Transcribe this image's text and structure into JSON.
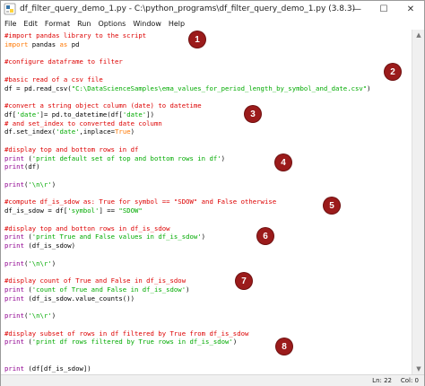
{
  "window": {
    "title": "df_filter_query_demo_1.py - C:\\python_programs\\df_filter_query_demo_1.py (3.8.3)",
    "minimize_glyph": "—",
    "maximize_glyph": "☐",
    "close_glyph": "✕",
    "app_icon": "python-idle-icon"
  },
  "menu": [
    "File",
    "Edit",
    "Format",
    "Run",
    "Options",
    "Window",
    "Help"
  ],
  "code_lines": [
    [
      {
        "t": "#import pandas library to the script",
        "c": "comment"
      }
    ],
    [
      {
        "t": "import",
        "c": "kw"
      },
      {
        "t": " pandas ",
        "c": "plain"
      },
      {
        "t": "as",
        "c": "kw"
      },
      {
        "t": " pd",
        "c": "plain"
      }
    ],
    [],
    [
      {
        "t": "#configure dataframe to filter",
        "c": "comment"
      }
    ],
    [],
    [
      {
        "t": "#basic read of a csv file",
        "c": "comment"
      }
    ],
    [
      {
        "t": "df = pd.read_csv(",
        "c": "plain"
      },
      {
        "t": "\"C:\\DataScienceSamples\\ema_values_for_period_length_by_symbol_and_date.csv\"",
        "c": "str"
      },
      {
        "t": ")",
        "c": "plain"
      }
    ],
    [],
    [
      {
        "t": "#convert a string object column (date) to datetime",
        "c": "comment"
      }
    ],
    [
      {
        "t": "df[",
        "c": "plain"
      },
      {
        "t": "'date'",
        "c": "str"
      },
      {
        "t": "]= pd.to_datetime(df[",
        "c": "plain"
      },
      {
        "t": "'date'",
        "c": "str"
      },
      {
        "t": "])",
        "c": "plain"
      }
    ],
    [
      {
        "t": "# and set_index to converted date column",
        "c": "comment"
      }
    ],
    [
      {
        "t": "df.set_index(",
        "c": "plain"
      },
      {
        "t": "'date'",
        "c": "str"
      },
      {
        "t": ",inplace=",
        "c": "plain"
      },
      {
        "t": "True",
        "c": "kw"
      },
      {
        "t": ")",
        "c": "plain"
      }
    ],
    [],
    [
      {
        "t": "#display top and bottom rows in df",
        "c": "comment"
      }
    ],
    [
      {
        "t": "print",
        "c": "fn"
      },
      {
        "t": " (",
        "c": "plain"
      },
      {
        "t": "'print default set of top and bottom rows in df'",
        "c": "str"
      },
      {
        "t": ")",
        "c": "plain"
      }
    ],
    [
      {
        "t": "print",
        "c": "fn"
      },
      {
        "t": "(df)",
        "c": "plain"
      }
    ],
    [],
    [
      {
        "t": "print",
        "c": "fn"
      },
      {
        "t": "(",
        "c": "plain"
      },
      {
        "t": "'\\n\\r'",
        "c": "str"
      },
      {
        "t": ")",
        "c": "plain"
      }
    ],
    [],
    [
      {
        "t": "#compute df_is_sdow as: True for symbol == \"SDOW\" and False otherwise",
        "c": "comment"
      }
    ],
    [
      {
        "t": "df_is_sdow = df[",
        "c": "plain"
      },
      {
        "t": "'symbol'",
        "c": "str"
      },
      {
        "t": "] == ",
        "c": "plain"
      },
      {
        "t": "\"SDOW\"",
        "c": "str"
      }
    ],
    [],
    [
      {
        "t": "#display top and botton rows in df_is_sdow",
        "c": "comment"
      }
    ],
    [
      {
        "t": "print",
        "c": "fn"
      },
      {
        "t": " (",
        "c": "plain"
      },
      {
        "t": "'print True and False values in df_is_sdow'",
        "c": "str"
      },
      {
        "t": ")",
        "c": "plain"
      }
    ],
    [
      {
        "t": "print",
        "c": "fn"
      },
      {
        "t": " (df_is_sdow)",
        "c": "plain"
      }
    ],
    [],
    [
      {
        "t": "print",
        "c": "fn"
      },
      {
        "t": "(",
        "c": "plain"
      },
      {
        "t": "'\\n\\r'",
        "c": "str"
      },
      {
        "t": ")",
        "c": "plain"
      }
    ],
    [],
    [
      {
        "t": "#display count of True and False in df_is_sdow",
        "c": "comment"
      }
    ],
    [
      {
        "t": "print",
        "c": "fn"
      },
      {
        "t": " (",
        "c": "plain"
      },
      {
        "t": "'count of True and False in df_is_sdow'",
        "c": "str"
      },
      {
        "t": ")",
        "c": "plain"
      }
    ],
    [
      {
        "t": "print",
        "c": "fn"
      },
      {
        "t": " (df_is_sdow.value_counts())",
        "c": "plain"
      }
    ],
    [],
    [
      {
        "t": "print",
        "c": "fn"
      },
      {
        "t": "(",
        "c": "plain"
      },
      {
        "t": "'\\n\\r'",
        "c": "str"
      },
      {
        "t": ")",
        "c": "plain"
      }
    ],
    [],
    [
      {
        "t": "#display subset of rows in df filtered by True from df_is_sdow",
        "c": "comment"
      }
    ],
    [
      {
        "t": "print",
        "c": "fn"
      },
      {
        "t": " (",
        "c": "plain"
      },
      {
        "t": "'print df rows filtered by True rows in df_is_sdow'",
        "c": "str"
      },
      {
        "t": ")",
        "c": "plain"
      }
    ],
    [],
    [],
    [
      {
        "t": "print",
        "c": "fn"
      },
      {
        "t": " (df[df_is_sdow])",
        "c": "plain"
      }
    ]
  ],
  "badges": [
    "1",
    "2",
    "3",
    "4",
    "5",
    "6",
    "7",
    "8"
  ],
  "status": {
    "line": "Ln: 22",
    "col": "Col: 0"
  },
  "colors": {
    "comment": "#dd0000",
    "keyword": "#ff7700",
    "string": "#00aa00",
    "builtin": "#900090",
    "badge": "#9b1b1b"
  }
}
